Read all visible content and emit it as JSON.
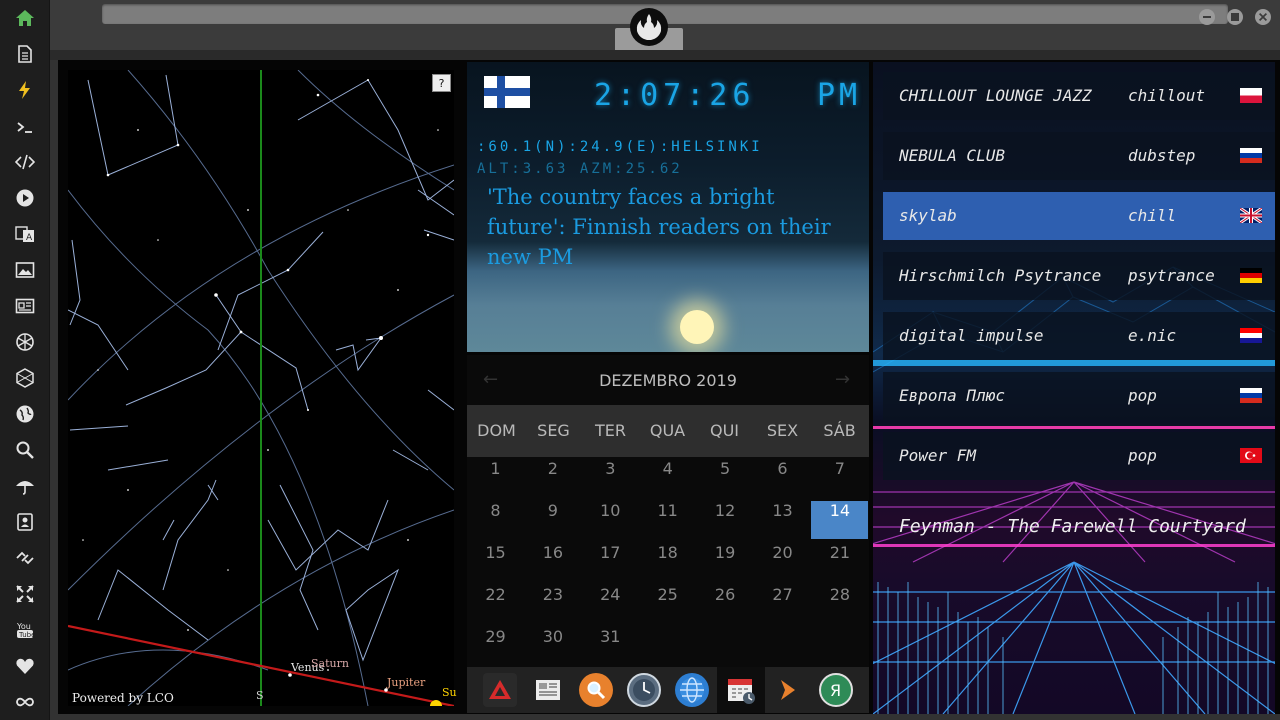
{
  "sidebar": {
    "icons": [
      "home-icon",
      "document-icon",
      "lightning-icon",
      "terminal-icon",
      "code-icon",
      "play-icon",
      "translate-icon",
      "image-icon",
      "news-icon",
      "aperture-icon",
      "hexagon-icon",
      "globe-icon",
      "search-icon",
      "umbrella-icon",
      "contact-icon",
      "link-icon",
      "expand-icon",
      "youtube-icon",
      "heart-icon",
      "infinity-icon"
    ],
    "active_color": "#5cb85c"
  },
  "clock": {
    "time": "2:07:26",
    "ampm": "PM",
    "location": ":60.1(N):24.9(E):HELSINKI",
    "altitude": "ALT:3.63 AZM:25.62",
    "news": "'The country faces a bright future': Finnish readers on their new PM"
  },
  "skymap": {
    "powered": "Powered by LCO",
    "planets": [
      "Venus",
      "Saturn",
      "Jupiter",
      "Su"
    ],
    "south_label": "S",
    "help": "?"
  },
  "calendar": {
    "title": "DEZEMBRO 2019",
    "weekdays": [
      "DOM",
      "SEG",
      "TER",
      "QUA",
      "QUI",
      "SEX",
      "SÁB"
    ],
    "days": [
      "1",
      "2",
      "3",
      "4",
      "5",
      "6",
      "7",
      "8",
      "9",
      "10",
      "11",
      "12",
      "13",
      "14",
      "15",
      "16",
      "17",
      "18",
      "19",
      "20",
      "21",
      "22",
      "23",
      "24",
      "25",
      "26",
      "27",
      "28",
      "29",
      "30",
      "31"
    ],
    "today": "14"
  },
  "dock": {
    "apps": [
      "red-triangle-app-icon",
      "news-app-icon",
      "search-app-icon",
      "clock-app-icon",
      "globe-app-icon",
      "calendar-app-icon",
      "arrow-app-icon",
      "yandex-app-icon"
    ]
  },
  "radio": {
    "stations": [
      {
        "name": "CHILLOUT LOUNGE JAZZ",
        "genre": "chillout",
        "flag": "poland"
      },
      {
        "name": "NEBULA CLUB",
        "genre": "dubstep",
        "flag": "russia"
      },
      {
        "name": "skylab",
        "genre": "chill",
        "flag": "uk"
      },
      {
        "name": "Hirschmilch Psytrance",
        "genre": "psytrance",
        "flag": "germany"
      },
      {
        "name": "digital impulse",
        "genre": "e.nic",
        "flag": "croatia"
      },
      {
        "name": "Европа Плюс",
        "genre": "pop",
        "flag": "russia"
      },
      {
        "name": "Power FM",
        "genre": "pop",
        "flag": "turkey"
      }
    ],
    "selected": "skylab",
    "now_playing": "Feynman - The Farewell Courtyard"
  },
  "colors": {
    "clock_blue": "#1aa5e6",
    "today_highlight": "#4a86c8",
    "selected_station": "#2e5fb0"
  }
}
